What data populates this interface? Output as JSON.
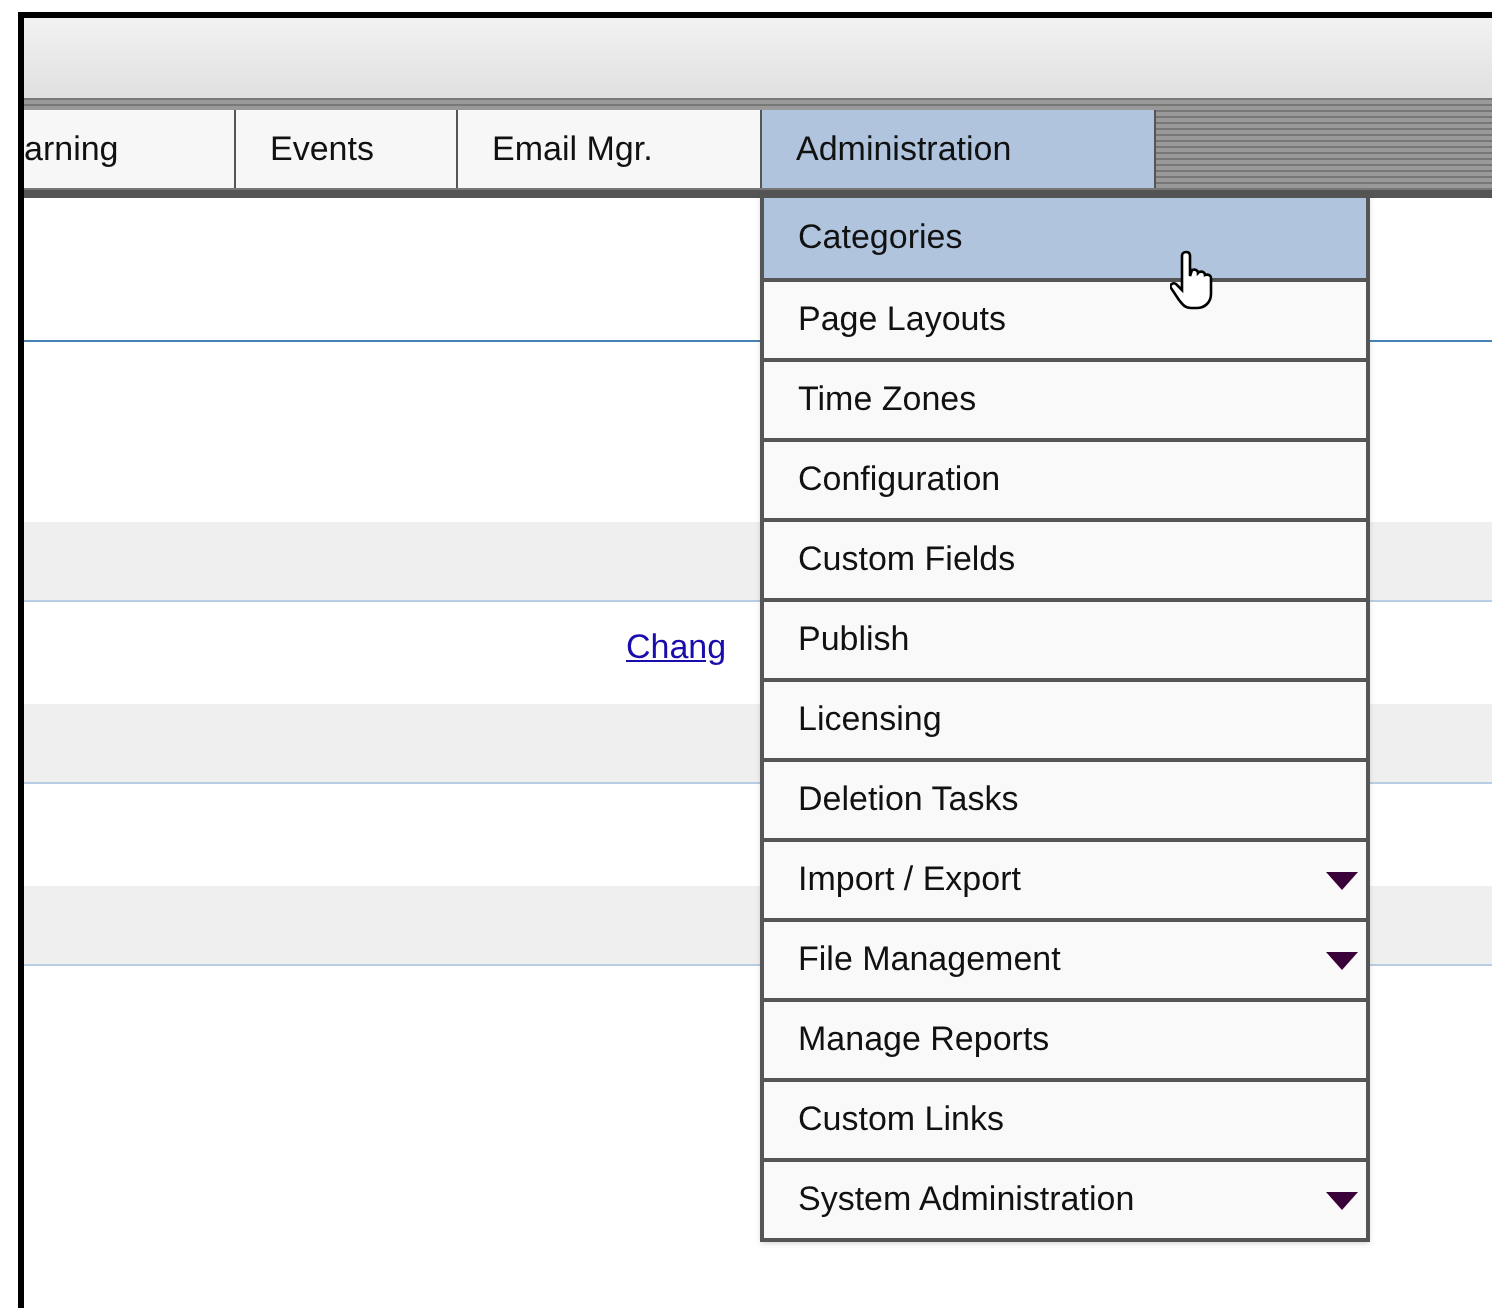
{
  "tabs": [
    {
      "label": "arning",
      "selected": false
    },
    {
      "label": "Events",
      "selected": false
    },
    {
      "label": "Email Mgr.",
      "selected": false
    },
    {
      "label": "Administration",
      "selected": true
    }
  ],
  "menu": [
    {
      "label": "Categories",
      "selected": true,
      "has_submenu": false
    },
    {
      "label": "Page Layouts",
      "selected": false,
      "has_submenu": false
    },
    {
      "label": "Time Zones",
      "selected": false,
      "has_submenu": false
    },
    {
      "label": "Configuration",
      "selected": false,
      "has_submenu": false
    },
    {
      "label": "Custom Fields",
      "selected": false,
      "has_submenu": false
    },
    {
      "label": "Publish",
      "selected": false,
      "has_submenu": false
    },
    {
      "label": "Licensing",
      "selected": false,
      "has_submenu": false
    },
    {
      "label": "Deletion Tasks",
      "selected": false,
      "has_submenu": false
    },
    {
      "label": "Import / Export",
      "selected": false,
      "has_submenu": true
    },
    {
      "label": "File Management",
      "selected": false,
      "has_submenu": true
    },
    {
      "label": "Manage Reports",
      "selected": false,
      "has_submenu": false
    },
    {
      "label": "Custom Links",
      "selected": false,
      "has_submenu": false
    },
    {
      "label": "System Administration",
      "selected": false,
      "has_submenu": true
    }
  ],
  "link": "Chang"
}
